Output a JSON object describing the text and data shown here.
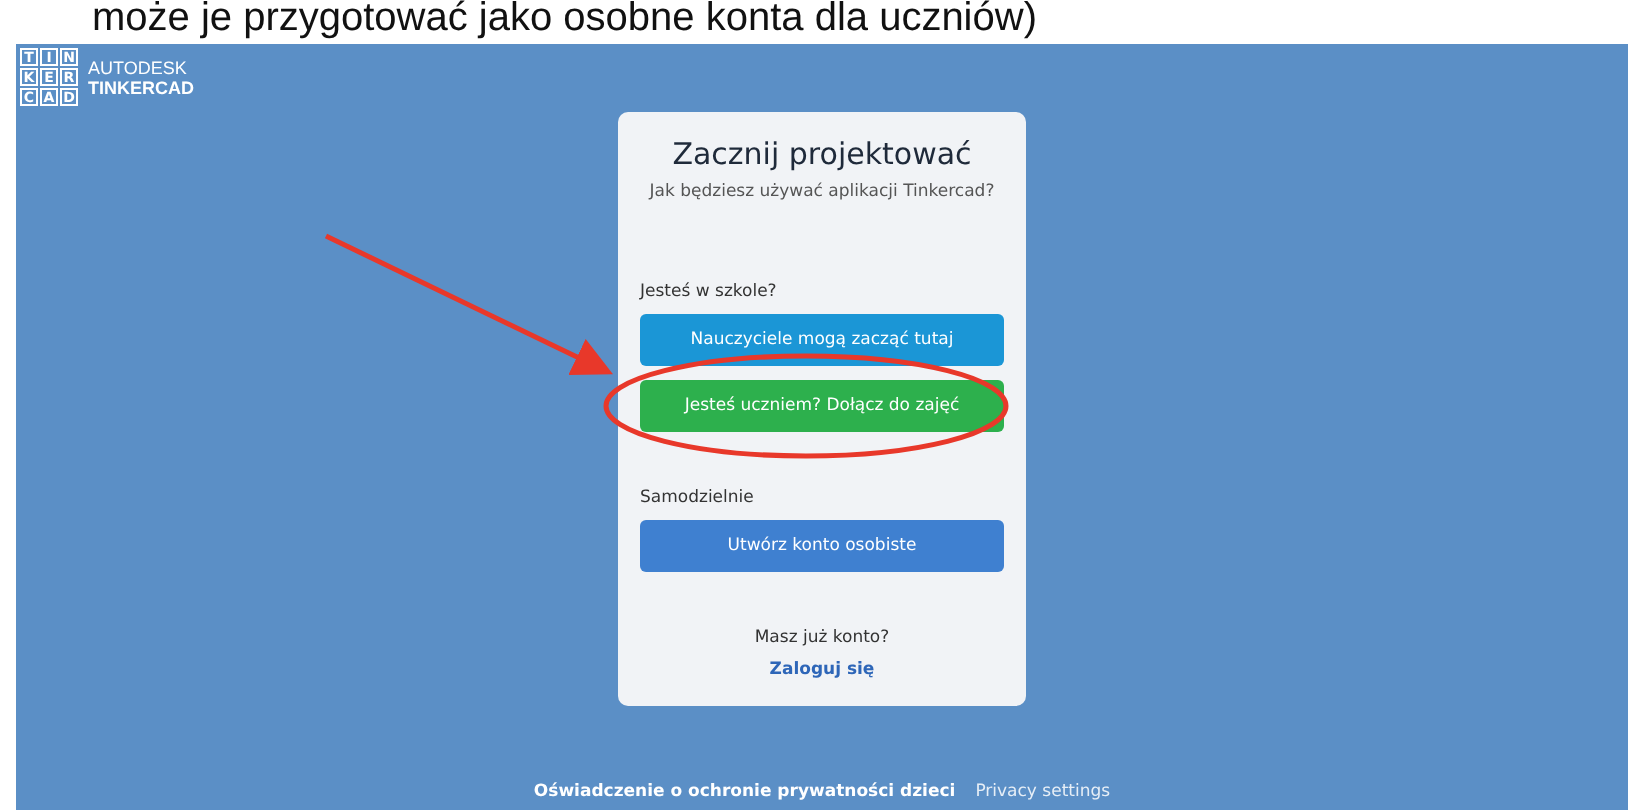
{
  "document_text": "może je przygotować jako osobne konta dla uczniów)",
  "logo": {
    "letters": [
      "T",
      "I",
      "N",
      "K",
      "E",
      "R",
      "C",
      "A",
      "D"
    ],
    "brand": "AUTODESK",
    "product": "TINKERCAD"
  },
  "card": {
    "title": "Zacznij projektować",
    "subtitle": "Jak będziesz używać aplikacji Tinkercad?",
    "sections": [
      {
        "label": "Jesteś w szkole?",
        "buttons": [
          {
            "label": "Nauczyciele mogą zacząć tutaj",
            "color": "#1b96d6"
          },
          {
            "label": "Jesteś uczniem? Dołącz do zajęć",
            "color": "#2db04d"
          }
        ]
      },
      {
        "label": "Samodzielnie",
        "buttons": [
          {
            "label": "Utwórz konto osobiste",
            "color": "#3f80d0"
          }
        ]
      }
    ],
    "signin_prompt": "Masz już konto?",
    "signin_link": "Zaloguj się"
  },
  "footer": [
    {
      "label": "Oświadczenie o ochronie prywatności dzieci",
      "bold": true
    },
    {
      "label": "Privacy settings",
      "bold": false
    }
  ]
}
